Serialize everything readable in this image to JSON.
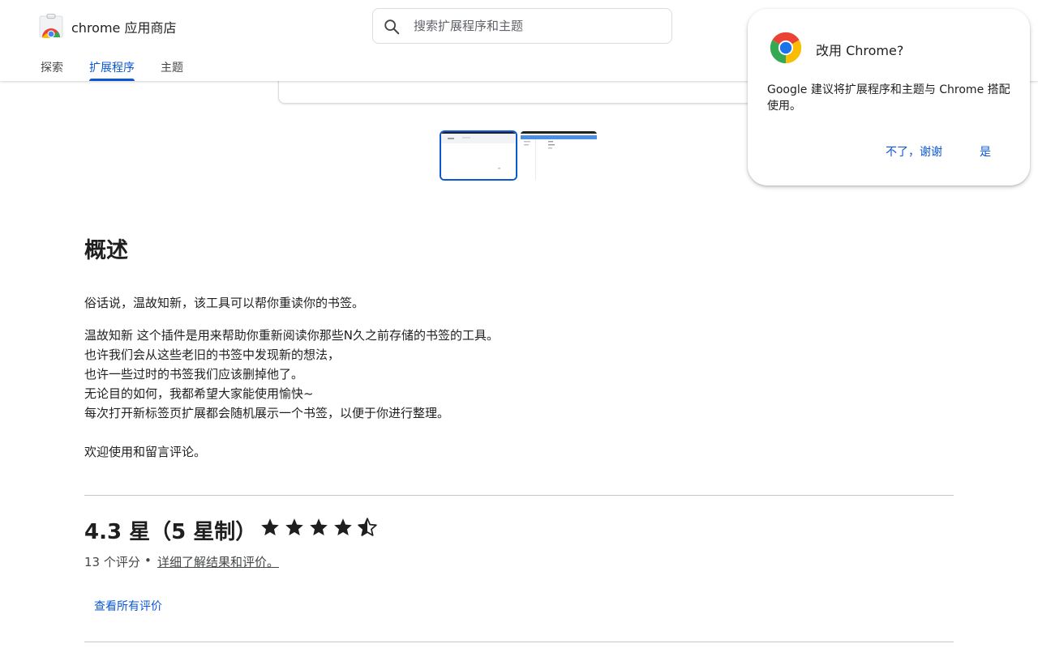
{
  "header": {
    "app_title": "chrome 应用商店",
    "search_placeholder": "搜索扩展程序和主题",
    "tabs": [
      {
        "label": "探索",
        "active": false
      },
      {
        "label": "扩展程序",
        "active": true
      },
      {
        "label": "主题",
        "active": false
      }
    ]
  },
  "overview": {
    "heading": "概述",
    "lines": [
      "俗话说，温故知新，该工具可以帮你重读你的书签。",
      "温故知新 这个插件是用来帮助你重新阅读你那些N久之前存储的书签的工具。",
      "也许我们会从这些老旧的书签中发现新的想法，",
      "也许一些过时的书签我们应该删掉他了。",
      "无论目的如何，我都希望大家能使用愉快~",
      "每次打开新标签页扩展都会随机展示一个书签，以便于你进行整理。",
      "欢迎使用和留言评论。"
    ]
  },
  "rating": {
    "value_text": "4.3 星（5 星制）",
    "stars_value": 4.3,
    "stars_max": 5,
    "count_text": "13 个评分",
    "separator": "•",
    "learn_more": "详细了解结果和评价。",
    "see_all": "查看所有评价"
  },
  "popup": {
    "title": "改用 Chrome?",
    "body": "Google 建议将扩展程序和主题与 Chrome 搭配使用。",
    "no_label": "不了，谢谢",
    "yes_label": "是"
  },
  "colors": {
    "accent": "#0b57d0",
    "text": "#1f1f1f",
    "secondary_text": "#444746",
    "divider": "#c4c7c5"
  },
  "icons": {
    "store_logo": "chrome-web-store-logo",
    "search": "search-icon",
    "chrome": "chrome-logo",
    "star_full": "star-full-icon",
    "star_half": "star-half-icon"
  }
}
